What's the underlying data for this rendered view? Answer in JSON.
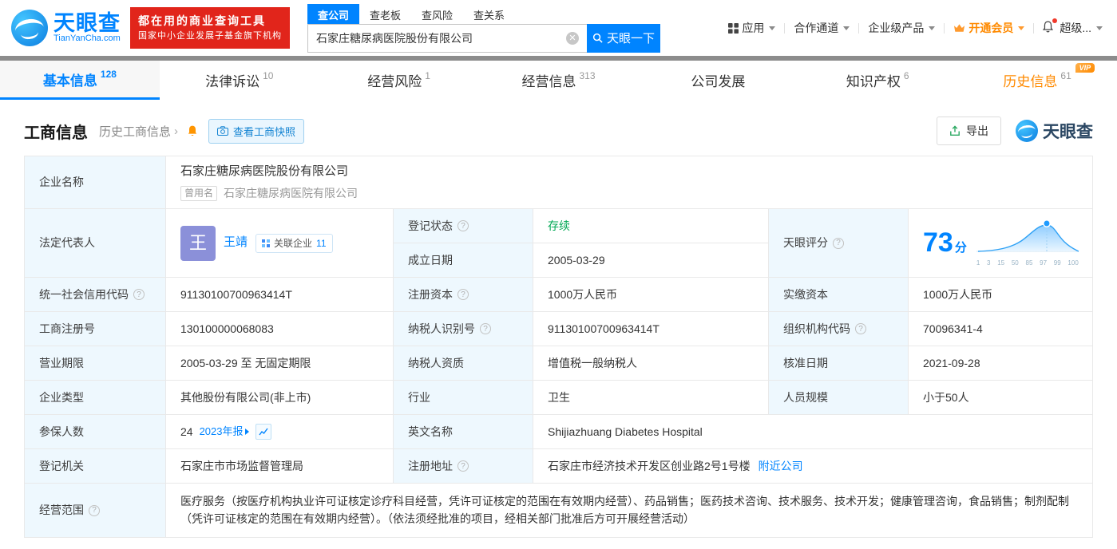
{
  "colors": {
    "accent": "#0084ff",
    "banner_red": "#e1251b",
    "vip_orange": "#ff8a00",
    "status_green": "#00a854",
    "label_bg": "#eef8fe"
  },
  "header": {
    "logo": {
      "brand": "天眼查",
      "domain": "TianYanCha.com"
    },
    "banner": {
      "line1": "都在用的商业查询工具",
      "line2": "国家中小企业发展子基金旗下机构"
    },
    "search_tabs": {
      "company": "查公司",
      "boss": "查老板",
      "risk": "查风险",
      "relation": "查关系"
    },
    "search": {
      "value": "石家庄糖尿病医院股份有限公司",
      "button": "天眼一下"
    },
    "nav": {
      "apps": "应用",
      "cooperation": "合作通道",
      "enterprise": "企业级产品",
      "vip": "开通会员",
      "super": "超级..."
    }
  },
  "tabs": [
    {
      "label": "基本信息",
      "count": "128"
    },
    {
      "label": "法律诉讼",
      "count": "10"
    },
    {
      "label": "经营风险",
      "count": "1"
    },
    {
      "label": "经营信息",
      "count": "313"
    },
    {
      "label": "公司发展",
      "count": ""
    },
    {
      "label": "知识产权",
      "count": "6"
    },
    {
      "label": "历史信息",
      "count": "61",
      "badge": "VIP"
    }
  ],
  "toolbar": {
    "title": "工商信息",
    "history_link": "历史工商信息",
    "history_arrow": "›",
    "snapshot_button": "查看工商快照",
    "export_button": "导出",
    "watermark": "天眼查"
  },
  "company": {
    "name_label": "企业名称",
    "name": "石家庄糖尿病医院股份有限公司",
    "former_tag": "曾用名",
    "former_name": "石家庄糖尿病医院有限公司",
    "legal_rep_label": "法定代表人",
    "avatar_char": "王",
    "legal_rep": "王靖",
    "related_tag": "关联企业",
    "related_count": "11",
    "reg_status_label": "登记状态",
    "reg_status": "存续",
    "establish_label": "成立日期",
    "establish_date": "2005-03-29",
    "score_label": "天眼评分",
    "score": "73",
    "score_unit": "分",
    "score_axis": [
      "1",
      "3",
      "15",
      "50",
      "85",
      "97",
      "99",
      "100"
    ],
    "credit_code_label": "统一社会信用代码",
    "credit_code": "91130100700963414T",
    "reg_capital_label": "注册资本",
    "reg_capital": "1000万人民币",
    "paid_capital_label": "实缴资本",
    "paid_capital": "1000万人民币",
    "reg_number_label": "工商注册号",
    "reg_number": "130100000068083",
    "taxpayer_id_label": "纳税人识别号",
    "taxpayer_id": "91130100700963414T",
    "org_code_label": "组织机构代码",
    "org_code": "70096341-4",
    "business_term_label": "营业期限",
    "business_term": "2005-03-29 至 无固定期限",
    "taxpayer_quality_label": "纳税人资质",
    "taxpayer_quality": "增值税一般纳税人",
    "approval_date_label": "核准日期",
    "approval_date": "2021-09-28",
    "company_type_label": "企业类型",
    "company_type": "其他股份有限公司(非上市)",
    "industry_label": "行业",
    "industry": "卫生",
    "staff_size_label": "人员规模",
    "staff_size": "小于50人",
    "insured_label": "参保人数",
    "insured": "24",
    "annual_report": "2023年报",
    "english_name_label": "英文名称",
    "english_name": "Shijiazhuang Diabetes Hospital",
    "reg_authority_label": "登记机关",
    "reg_authority": "石家庄市市场监督管理局",
    "address_label": "注册地址",
    "address": "石家庄市经济技术开发区创业路2号1号楼",
    "nearby_link": "附近公司",
    "scope_label": "经营范围",
    "scope": "医疗服务（按医疗机构执业许可证核定诊疗科目经营，凭许可证核定的范围在有效期内经营）、药品销售；医药技术咨询、技术服务、技术开发；健康管理咨询，食品销售；制剂配制（凭许可证核定的范围在有效期内经营）。（依法须经批准的项目，经相关部门批准后方可开展经营活动）"
  }
}
